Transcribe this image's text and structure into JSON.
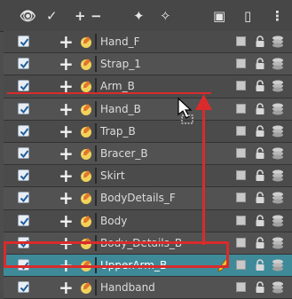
{
  "toolbar": {
    "icons": [
      {
        "name": "show-all-icon",
        "glyph": "👁"
      },
      {
        "name": "enable-all-icon",
        "glyph": "✓"
      },
      {
        "name": "add-layer-icon",
        "glyph": "+"
      },
      {
        "name": "remove-layer-icon",
        "glyph": "−"
      },
      {
        "name": "add-drawing-layer-icon",
        "glyph": "✦"
      },
      {
        "name": "add-color-layer-icon",
        "glyph": "✧"
      },
      {
        "name": "camera-icon",
        "glyph": "▣"
      },
      {
        "name": "peg-icon",
        "glyph": "▯"
      },
      {
        "name": "more-options-icon",
        "glyph": "⋮"
      }
    ]
  },
  "layers": [
    {
      "name": "Hand_F",
      "selected": false
    },
    {
      "name": "Strap_1",
      "selected": false
    },
    {
      "name": "Arm_B",
      "selected": false
    },
    {
      "name": "Hand_B",
      "selected": false
    },
    {
      "name": "Trap_B",
      "selected": false
    },
    {
      "name": "Bracer_B",
      "selected": false
    },
    {
      "name": "Skirt",
      "selected": false
    },
    {
      "name": "BodyDetails_F",
      "selected": false
    },
    {
      "name": "Body",
      "selected": false
    },
    {
      "name": "Body_Details_B",
      "selected": false
    },
    {
      "name": "UpperArm_B",
      "selected": true
    },
    {
      "name": "Handband",
      "selected": false
    }
  ],
  "colors": {
    "highlight": "#d92b2b",
    "selected_row": "#3e8a99"
  }
}
